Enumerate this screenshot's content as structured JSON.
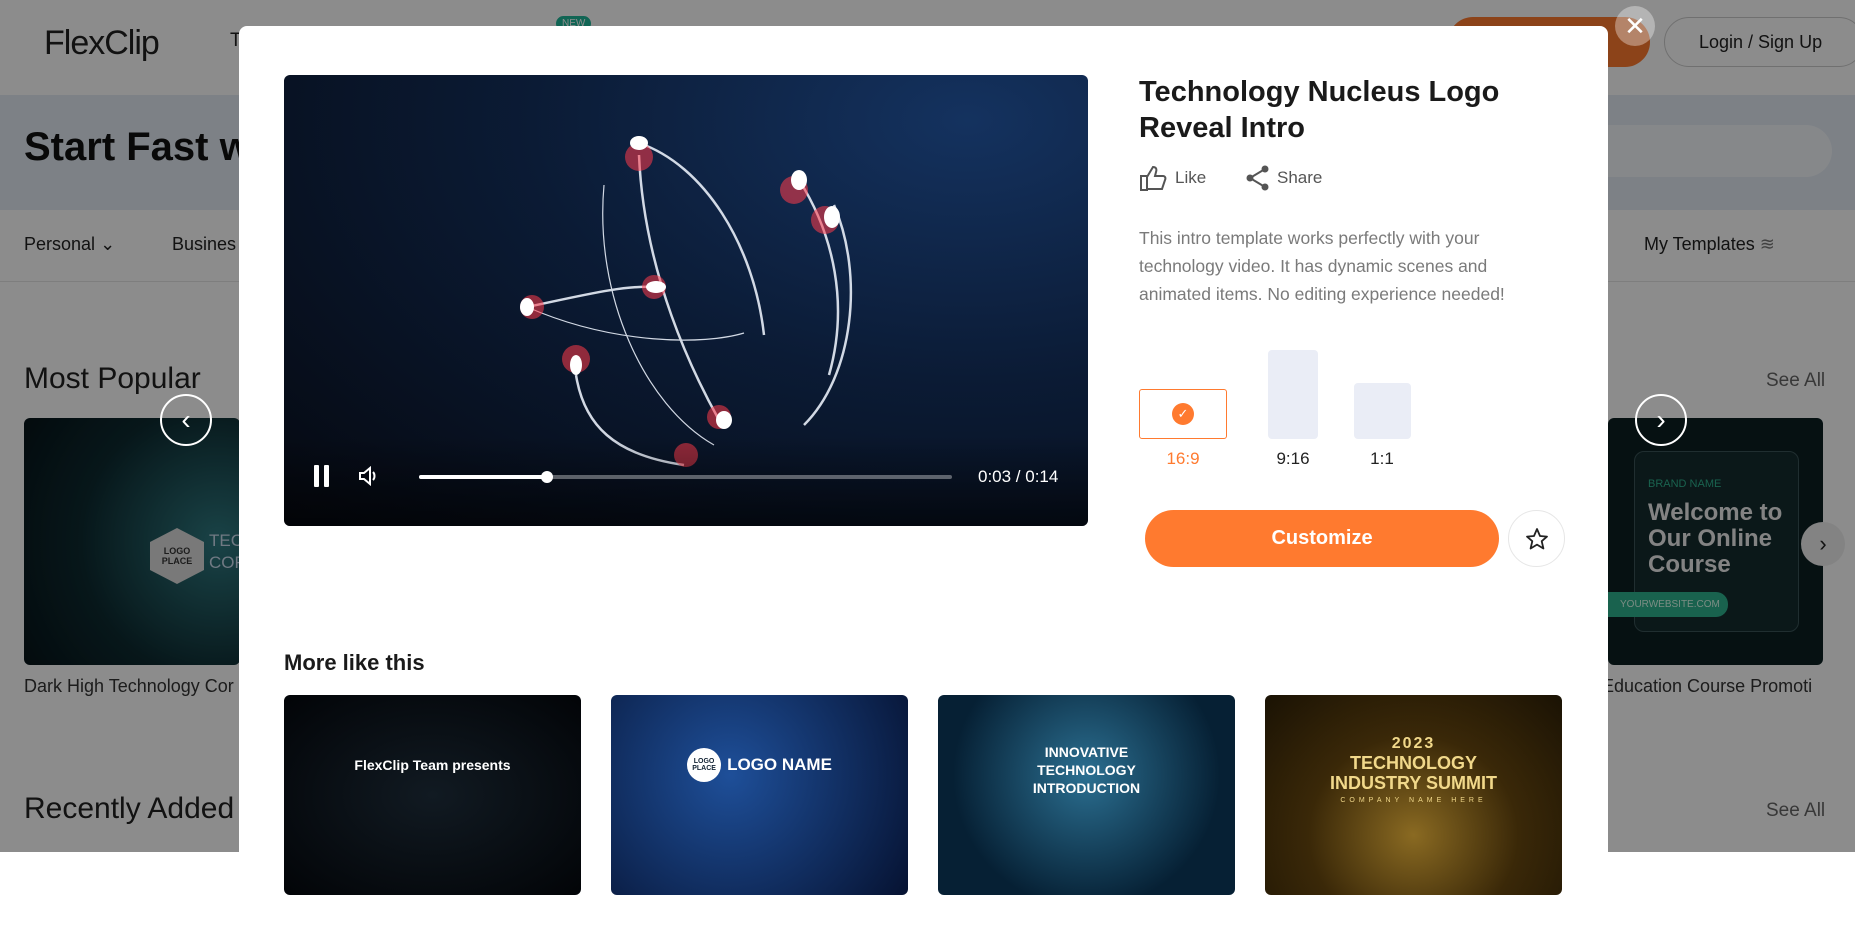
{
  "header": {
    "logo": "FlexClip",
    "nav_partial": "T",
    "new_badge": "NEW",
    "login": "Login / Sign Up"
  },
  "banner": {
    "title_partial": "Start Fast w"
  },
  "nav": {
    "personal": "Personal",
    "business_partial": "Busines",
    "my_templates": "My Templates"
  },
  "sections": {
    "most_popular": "Most Popular",
    "recently_added": "Recently Added",
    "see_all": "See All",
    "left_card_title": "Dark High Technology Cor",
    "left_card_logo": "LOGO PLACE",
    "left_card_text": "TEC COR",
    "right_card_title": "Education Course Promoti",
    "right_card_brand": "BRAND NAME",
    "right_card_heading": "Welcome to Our Online Course",
    "right_card_url": "YOURWEBSITE.COM"
  },
  "modal": {
    "title": "Technology Nucleus Logo Reveal Intro",
    "like": "Like",
    "share": "Share",
    "description": "This intro template works perfectly with your technology video. It has dynamic scenes and animated items. No editing experience needed!",
    "video": {
      "time": "0:03 / 0:14",
      "progress_percent": 24,
      "state": "playing"
    },
    "ratios": [
      {
        "label": "16:9",
        "selected": true
      },
      {
        "label": "9:16",
        "selected": false
      },
      {
        "label": "1:1",
        "selected": false
      }
    ],
    "customize": "Customize",
    "more_title": "More like this",
    "more": [
      {
        "text": "FlexClip Team presents"
      },
      {
        "text": "LOGO NAME",
        "logo": "LOGO PLACE"
      },
      {
        "text": "INNOVATIVE TECHNOLOGY INTRODUCTION"
      },
      {
        "year": "2023",
        "text": "TECHNOLOGY INDUSTRY SUMMIT",
        "sub": "COMPANY NAME HERE"
      }
    ]
  },
  "colors": {
    "accent": "#ff7a2f",
    "overlay": "rgba(0,0,0,0.45)"
  }
}
